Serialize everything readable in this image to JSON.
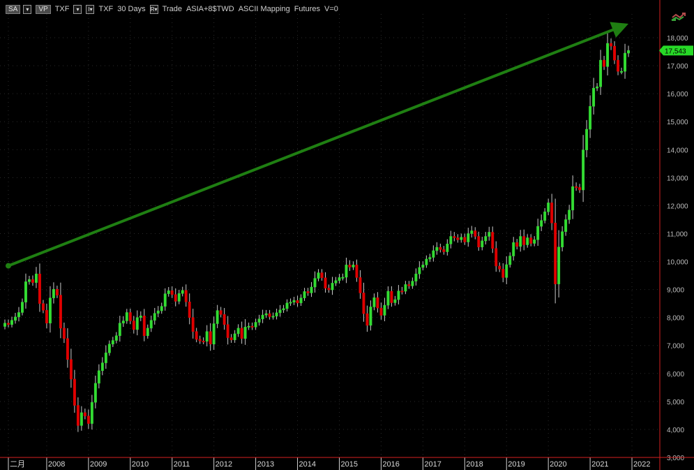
{
  "toolbar": {
    "sa_label": "SA",
    "vp_label": "VP",
    "symbol": "TXF",
    "bar_size": "30 Days",
    "trade": "Trade",
    "session": "ASIA+8$TWD",
    "mapping": "ASCII Mapping",
    "futures": "Futures",
    "volume": "V=0",
    "dropdown_glyph": "▾",
    "i_label": "I▾",
    "r_label": "R▾"
  },
  "icons": {
    "arrows": "refresh-arrows-icon"
  },
  "chart_data": {
    "type": "candlestick",
    "title": "",
    "xlabel": "",
    "ylabel": "",
    "ylim": [
      3000,
      18800
    ],
    "xlim": [
      "2007-01",
      "2022-06"
    ],
    "grid": true,
    "current_price": 17543,
    "current_price_label": "17,543",
    "x_ticks": [
      "二月",
      "2008",
      "2009",
      "2010",
      "2011",
      "2012",
      "2013",
      "2014",
      "2015",
      "2016",
      "2017",
      "2018",
      "2019",
      "2020",
      "2021",
      "2022"
    ],
    "y_ticks": [
      "3,000",
      "4,000",
      "5,000",
      "6,000",
      "7,000",
      "8,000",
      "9,000",
      "10,000",
      "11,000",
      "12,000",
      "13,000",
      "14,000",
      "15,000",
      "16,000",
      "17,000",
      "18,000"
    ],
    "annotation": {
      "type": "trend-arrow",
      "from": [
        "2007-02",
        9850
      ],
      "to": [
        "2021-12",
        18500
      ],
      "color": "#1f7f12"
    },
    "series": [
      {
        "close": [
          7800,
          7750,
          7900,
          8020,
          8180,
          8550,
          9280,
          9360,
          9250,
          9560,
          8500,
          8260,
          7800,
          8700,
          9010,
          8800,
          7620,
          7250,
          6500,
          5800,
          4860,
          4140,
          4600,
          4480,
          4210,
          4970,
          5650,
          6100,
          6380,
          6740,
          7050,
          7180,
          7350,
          7800,
          7880,
          8180,
          7880,
          7570,
          8000,
          8060,
          7350,
          7620,
          7900,
          8150,
          8240,
          8400,
          8850,
          8960,
          8820,
          8580,
          8860,
          8970,
          8560,
          8000,
          7500,
          7220,
          7160,
          7150,
          7500,
          7050,
          7780,
          8250,
          8110,
          7750,
          7280,
          7200,
          7420,
          7620,
          7250,
          7660,
          7690,
          7660,
          7830,
          7950,
          8090,
          8140,
          8030,
          8050,
          8170,
          8270,
          8320,
          8520,
          8550,
          8610,
          8520,
          8700,
          8930,
          8880,
          9090,
          9400,
          9600,
          9420,
          9050,
          8990,
          9230,
          9320,
          9430,
          9440,
          9880,
          9800,
          9880,
          9430,
          8880,
          8140,
          7720,
          8380,
          8710,
          8340,
          8080,
          8440,
          8940,
          8530,
          8640,
          8950,
          8940,
          9180,
          9130,
          9300,
          9560,
          9790,
          9880,
          10090,
          10150,
          10390,
          10510,
          10430,
          10350,
          10630,
          10900,
          10850,
          10780,
          10870,
          10700,
          11000,
          11100,
          10900,
          10520,
          10740,
          10900,
          11050,
          10470,
          9840,
          9730,
          9430,
          9890,
          10200,
          10680,
          10540,
          10900,
          10600,
          10850,
          10650,
          10780,
          11260,
          11470,
          11780,
          12100,
          11380,
          9200,
          10520,
          11070,
          11500,
          11840,
          12680,
          12650,
          12560,
          13990,
          14730,
          15550,
          16200,
          16250,
          17200,
          16970,
          17800,
          17700,
          17200,
          16800,
          16800,
          17450,
          17543
        ]
      }
    ]
  }
}
